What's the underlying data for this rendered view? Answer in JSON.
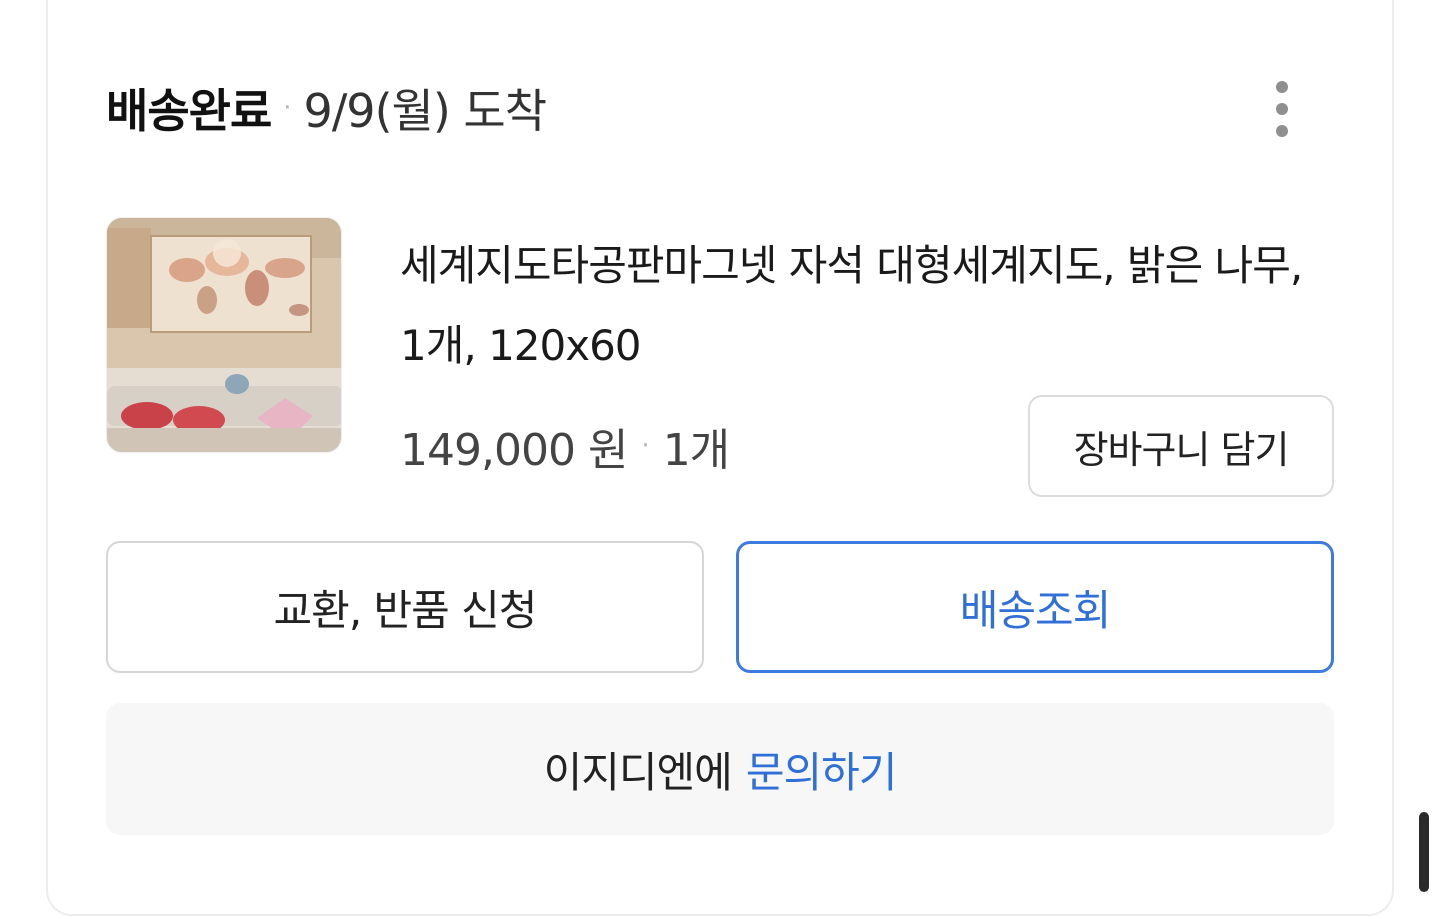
{
  "order": {
    "status": "배송완료",
    "separator": "·",
    "arrival": "9/9(월) 도착"
  },
  "product": {
    "name": "세계지도타공판마그넷 자석 대형세계지도, 밝은 나무, 1개, 120x60",
    "price": "149,000 원",
    "separator": "·",
    "quantity": "1개",
    "cart_button": "장바구니 담기"
  },
  "actions": {
    "return_button": "교환, 반품 신청",
    "tracking_button": "배송조회"
  },
  "inquiry": {
    "seller": "이지디엔에",
    "link": "문의하기"
  },
  "colors": {
    "accent": "#2f6fd8",
    "border": "#d6d6d6",
    "inquiry_bg": "#f7f7f7"
  },
  "icons": {
    "more": "more-vertical-icon"
  }
}
